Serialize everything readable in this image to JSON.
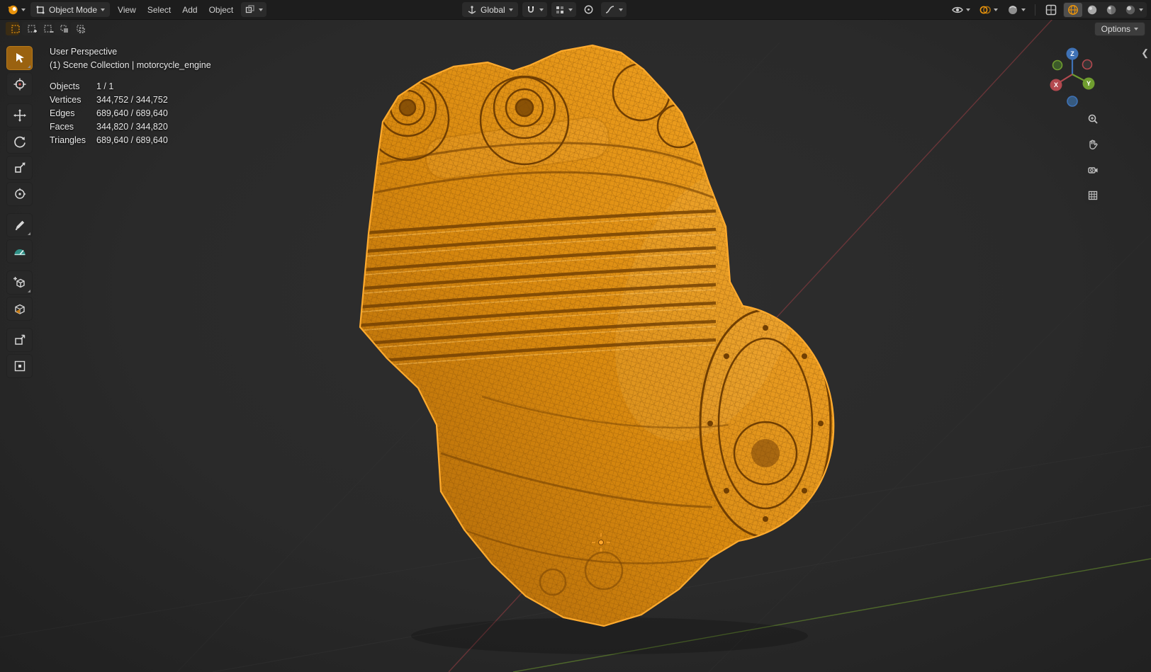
{
  "header": {
    "mode_label": "Object Mode",
    "menus": [
      {
        "label": "View"
      },
      {
        "label": "Select"
      },
      {
        "label": "Add"
      },
      {
        "label": "Object"
      }
    ],
    "orientation_label": "Global"
  },
  "tool_settings": {
    "options_label": "Options"
  },
  "toolbar_tools": [
    "select-box",
    "cursor",
    "move",
    "rotate",
    "scale",
    "transform",
    "annotate",
    "measure",
    "add-cube",
    "add-primitive",
    "extrude",
    "inset"
  ],
  "viewport": {
    "view_label": "User Perspective",
    "breadcrumb": "(1) Scene Collection | motorcycle_engine",
    "object_name": "motorcycle_engine",
    "stats": {
      "rows": [
        {
          "label": "Objects",
          "value": "1 / 1"
        },
        {
          "label": "Vertices",
          "value": "344,752 / 344,752"
        },
        {
          "label": "Edges",
          "value": "689,640 / 689,640"
        },
        {
          "label": "Faces",
          "value": "344,820 / 344,820"
        },
        {
          "label": "Triangles",
          "value": "689,640 / 689,640"
        }
      ]
    },
    "axis_gizmo": {
      "x": "X",
      "y": "Y",
      "z": "Z"
    }
  },
  "colors": {
    "selection_orange": "#ffa62b",
    "wire_orange": "#e8930c",
    "axis_x": "#b3494f",
    "axis_y": "#6f9d2f",
    "axis_z": "#3f72b6",
    "header_bg": "#1d1d1d",
    "viewport_bg": "#2b2b2b"
  }
}
